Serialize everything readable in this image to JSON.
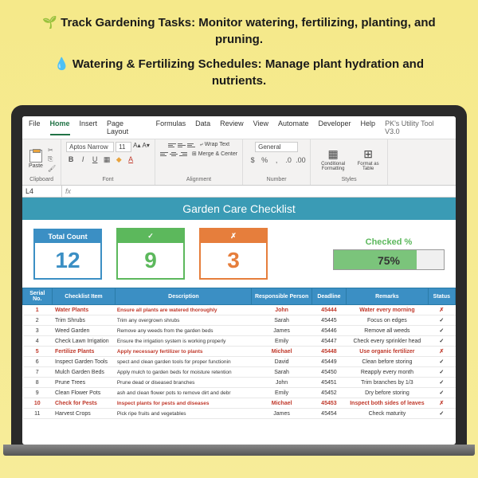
{
  "promo": {
    "line1": "🌱 Track Gardening Tasks: Monitor watering, fertilizing, planting, and pruning.",
    "line2": "💧 Watering & Fertilizing Schedules: Manage plant hydration and nutrients."
  },
  "menu": {
    "file": "File",
    "home": "Home",
    "insert": "Insert",
    "pagelayout": "Page Layout",
    "formulas": "Formulas",
    "data": "Data",
    "review": "Review",
    "view": "View",
    "automate": "Automate",
    "developer": "Developer",
    "help": "Help",
    "util": "PK's Utility Tool V3.0"
  },
  "ribbon": {
    "paste": "Paste",
    "clipboard": "Clipboard",
    "font_name": "Aptos Narrow",
    "font_size": "11",
    "font_label": "Font",
    "wrap": "Wrap Text",
    "merge": "Merge & Center",
    "align_label": "Alignment",
    "general": "General",
    "number_label": "Number",
    "cond": "Conditional Formatting",
    "table": "Format as Table",
    "styles_label": "Styles"
  },
  "namebox": {
    "cell": "L4",
    "fx": "fx"
  },
  "title": "Garden Care Checklist",
  "stats": {
    "total_label": "Total Count",
    "total_val": "12",
    "done_label": "✓",
    "done_val": "9",
    "miss_label": "✗",
    "miss_val": "3",
    "pct_label": "Checked %",
    "pct_val": "75%"
  },
  "headers": {
    "serial": "Serial No.",
    "item": "Checklist Item",
    "desc": "Description",
    "person": "Responsible Person",
    "deadline": "Deadline",
    "remarks": "Remarks",
    "status": "Status"
  },
  "rows": [
    {
      "n": "1",
      "item": "Water Plants",
      "desc": "Ensure all plants are watered thoroughly",
      "person": "John",
      "deadline": "45444",
      "remarks": "Water every morning",
      "status": "✗",
      "red": true
    },
    {
      "n": "2",
      "item": "Trim Shrubs",
      "desc": "Trim any overgrown shrubs",
      "person": "Sarah",
      "deadline": "45445",
      "remarks": "Focus on edges",
      "status": "✓",
      "red": false
    },
    {
      "n": "3",
      "item": "Weed Garden",
      "desc": "Remove any weeds from the garden beds",
      "person": "James",
      "deadline": "45446",
      "remarks": "Remove all weeds",
      "status": "✓",
      "red": false
    },
    {
      "n": "4",
      "item": "Check Lawn Irrigation",
      "desc": "Ensure the irrigation system is working properly",
      "person": "Emily",
      "deadline": "45447",
      "remarks": "Check every sprinkler head",
      "status": "✓",
      "red": false
    },
    {
      "n": "5",
      "item": "Fertilize Plants",
      "desc": "Apply necessary fertilizer to plants",
      "person": "Michael",
      "deadline": "45448",
      "remarks": "Use organic fertilizer",
      "status": "✗",
      "red": true
    },
    {
      "n": "6",
      "item": "Inspect Garden Tools",
      "desc": "spect and clean garden tools for proper functionin",
      "person": "David",
      "deadline": "45449",
      "remarks": "Clean before storing",
      "status": "✓",
      "red": false
    },
    {
      "n": "7",
      "item": "Mulch Garden Beds",
      "desc": "Apply mulch to garden beds for moisture retention",
      "person": "Sarah",
      "deadline": "45450",
      "remarks": "Reapply every month",
      "status": "✓",
      "red": false
    },
    {
      "n": "8",
      "item": "Prune Trees",
      "desc": "Prune dead or diseased branches",
      "person": "John",
      "deadline": "45451",
      "remarks": "Trim branches by 1/3",
      "status": "✓",
      "red": false
    },
    {
      "n": "9",
      "item": "Clean Flower Pots",
      "desc": "ash and clean flower pots to remove dirt and debr",
      "person": "Emily",
      "deadline": "45452",
      "remarks": "Dry before storing",
      "status": "✓",
      "red": false
    },
    {
      "n": "10",
      "item": "Check for Pests",
      "desc": "Inspect plants for pests and diseases",
      "person": "Michael",
      "deadline": "45453",
      "remarks": "Inspect both sides of leaves",
      "status": "✗",
      "red": true
    },
    {
      "n": "11",
      "item": "Harvest Crops",
      "desc": "Pick ripe fruits and vegetables",
      "person": "James",
      "deadline": "45454",
      "remarks": "Check maturity",
      "status": "✓",
      "red": false
    }
  ]
}
